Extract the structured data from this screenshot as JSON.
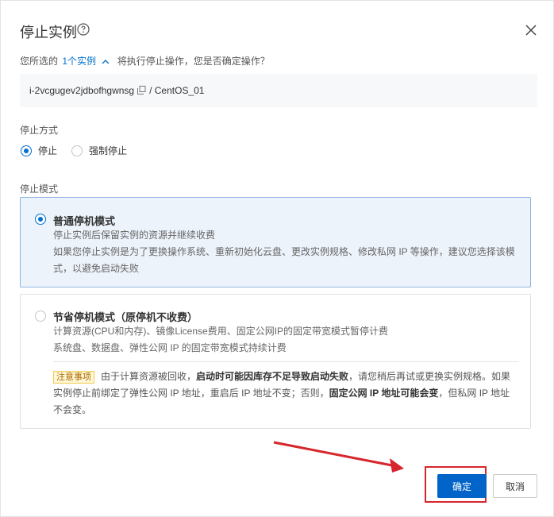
{
  "dialog": {
    "title": "停止实例",
    "prompt_prefix": "您所选的",
    "selected_link": "1个实例",
    "prompt_suffix": "将执行停止操作，您是否确定操作？",
    "instance_id": "i-2vcgugev2jdbofhgwnsg",
    "instance_name": "/ CentOS_01"
  },
  "stop_method": {
    "label": "停止方式",
    "options": [
      {
        "label": "停止",
        "checked": true
      },
      {
        "label": "强制停止",
        "checked": false
      }
    ]
  },
  "stop_mode": {
    "label": "停止模式",
    "normal": {
      "title": "普通停机模式",
      "desc_1": "停止实例后保留实例的资源并继续收费",
      "desc_2": "如果您停止实例是为了更换操作系统、重新初始化云盘、更改实例规格、修改私网 IP 等操作，建议您选择该模式，以避免启动失败",
      "checked": true
    },
    "economical": {
      "title": "节省停机模式（原停机不收费）",
      "desc_1": "计算资源(CPU和内存)、镜像License费用、固定公网IP的固定带宽模式暂停计费",
      "desc_2": "系统盘、数据盘、弹性公网 IP 的固定带宽模式持续计费",
      "checked": false,
      "note_badge": "注意事项",
      "note_1": "由于计算资源被回收，",
      "note_2": "启动时可能因库存不足导致启动失败",
      "note_3": "，请您稍后再试或更换实例规格。如果实例停止前绑定了弹性公网 IP 地址，重启后 IP 地址不变；否则，",
      "note_4": "固定公网 IP 地址可能会变",
      "note_5": "，但私网 IP 地址不会变。"
    }
  },
  "footer": {
    "confirm_label": "确定",
    "cancel_label": "取消"
  },
  "colors": {
    "accent": "#0064c8",
    "annotation_red": "#d7262b"
  },
  "icons": [
    "help-circle-icon",
    "close-icon",
    "chevron-up-icon",
    "copy-icon",
    "arrow-annotation-icon"
  ]
}
